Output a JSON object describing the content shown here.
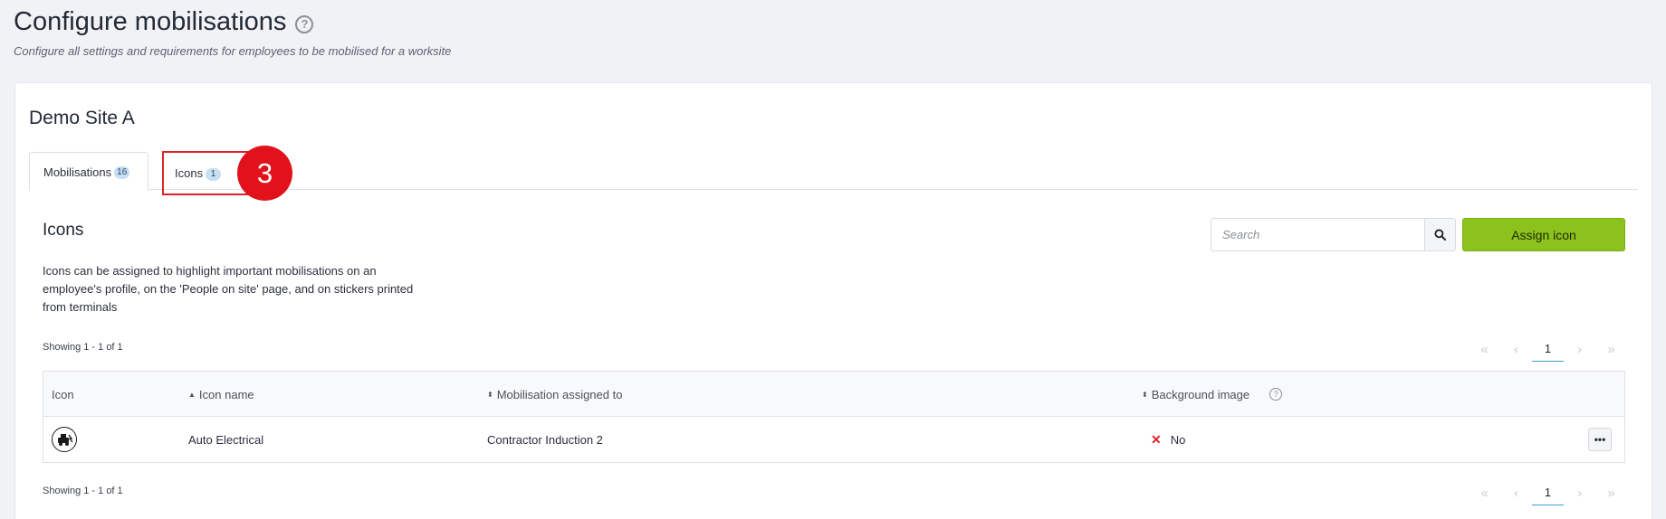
{
  "page": {
    "title": "Configure mobilisations",
    "subtitle": "Configure all settings and requirements for employees to be mobilised for a worksite"
  },
  "site": {
    "name": "Demo Site A"
  },
  "tabs": [
    {
      "label": "Mobilisations",
      "count": "16"
    },
    {
      "label": "Icons",
      "count": "1"
    }
  ],
  "step_marker": "3",
  "section": {
    "title": "Icons",
    "description": "Icons can be assigned to highlight important mobilisations on an employee's profile, on the 'People on site' page, and on stickers printed from terminals"
  },
  "search": {
    "placeholder": "Search",
    "value": ""
  },
  "assign_button": "Assign icon",
  "showing": "Showing 1 - 1 of 1",
  "pagination": {
    "first": "«",
    "prev": "‹",
    "current": "1",
    "next": "›",
    "last": "»"
  },
  "table": {
    "columns": [
      {
        "label": "Icon",
        "sort": ""
      },
      {
        "label": "Icon name",
        "sort": "▲"
      },
      {
        "label": "Mobilisation assigned to",
        "sort": "⬍"
      },
      {
        "label": "Background image",
        "sort": "⬍"
      }
    ],
    "rows": [
      {
        "icon": "auto-electrical-icon",
        "name": "Auto Electrical",
        "mobilisation": "Contractor Induction 2",
        "background_image": "No"
      }
    ]
  },
  "colors": {
    "accent": "#8cc21c",
    "marker": "#e2121c",
    "badge": "#c6dff3"
  }
}
